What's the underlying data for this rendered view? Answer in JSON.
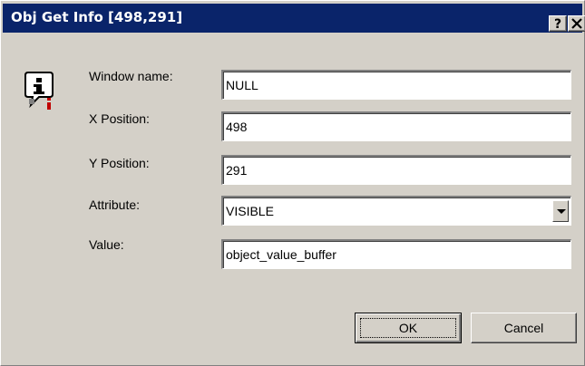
{
  "window": {
    "title": "Obj Get Info [498,291]",
    "help_label": "?",
    "close_label": "✕"
  },
  "icons": {
    "dialog_icon": "info-icon"
  },
  "form": {
    "window_name": {
      "label": "Window name:",
      "value": "NULL"
    },
    "x_position": {
      "label": "X Position:",
      "value": "498"
    },
    "y_position": {
      "label": "Y Position:",
      "value": "291"
    },
    "attribute": {
      "label": "Attribute:",
      "value": "VISIBLE"
    },
    "value": {
      "label": "Value:",
      "value": "object_value_buffer"
    }
  },
  "buttons": {
    "ok_label": "OK",
    "cancel_label": "Cancel"
  },
  "colors": {
    "titlebar": "#0a246a",
    "face": "#d4d0c8"
  }
}
